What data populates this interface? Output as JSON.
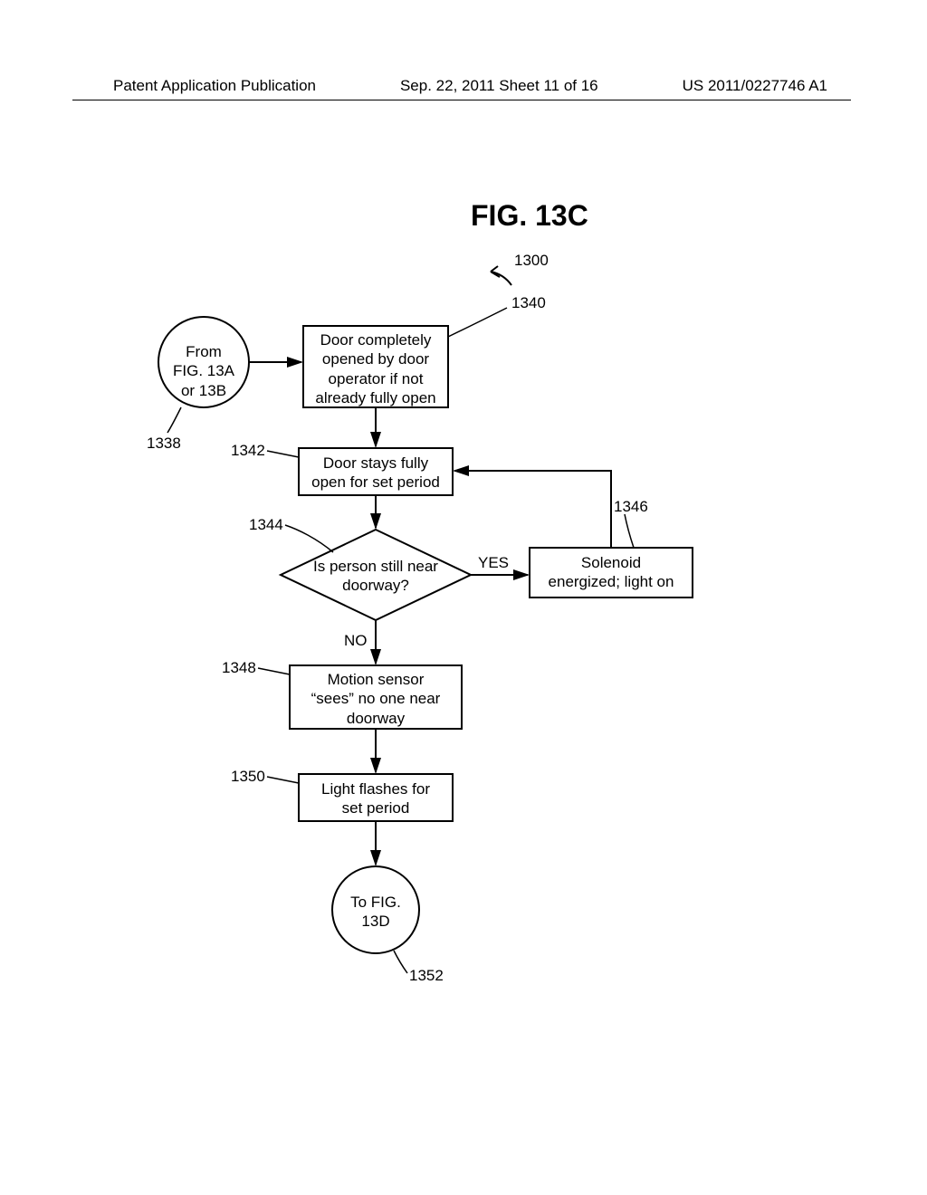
{
  "header": {
    "left": "Patent Application Publication",
    "center": "Sep. 22, 2011  Sheet 11 of 16",
    "right": "US 2011/0227746 A1"
  },
  "figure_title": "FIG. 13C",
  "refs": {
    "r1300": "1300",
    "r1338": "1338",
    "r1340": "1340",
    "r1342": "1342",
    "r1344": "1344",
    "r1346": "1346",
    "r1348": "1348",
    "r1350": "1350",
    "r1352": "1352"
  },
  "nodes": {
    "from_circle_l1": "From",
    "from_circle_l2": "FIG. 13A",
    "from_circle_l3": "or 13B",
    "box1340_l1": "Door completely",
    "box1340_l2": "opened by door",
    "box1340_l3": "operator if not",
    "box1340_l4": "already fully open",
    "box1342_l1": "Door stays fully",
    "box1342_l2": "open for set period",
    "diamond1344": "Is person still near\ndoorway?",
    "box1346_l1": "Solenoid",
    "box1346_l2": "energized; light on",
    "box1348_l1": "Motion sensor",
    "box1348_l2": "“sees” no one near",
    "box1348_l3": "doorway",
    "box1350_l1": "Light flashes for",
    "box1350_l2": "set period",
    "to_circle_l1": "To FIG.",
    "to_circle_l2": "13D",
    "yes": "YES",
    "no": "NO"
  }
}
